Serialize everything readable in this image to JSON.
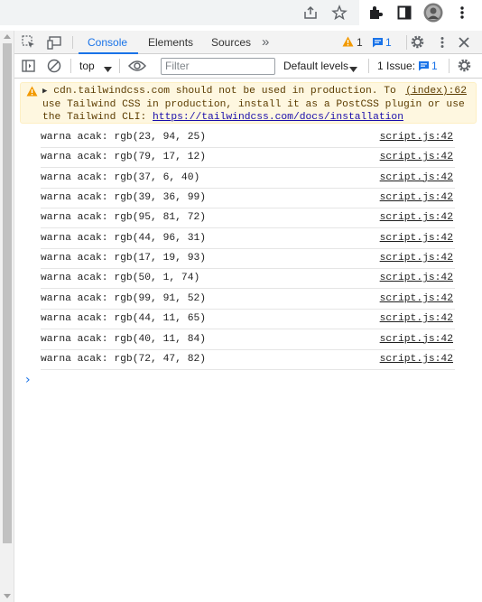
{
  "browser": {
    "icons": [
      "share-icon",
      "star-icon",
      "extensions-icon",
      "side-panel-icon",
      "profile-avatar",
      "menu-icon"
    ]
  },
  "devtools": {
    "tabs": [
      {
        "label": "Console",
        "active": true
      },
      {
        "label": "Elements",
        "active": false
      },
      {
        "label": "Sources",
        "active": false
      }
    ],
    "more_tabs": "»",
    "warning_count": "1",
    "message_count": "1"
  },
  "toolbar": {
    "context": "top",
    "filter_placeholder": "Filter",
    "levels": "Default levels",
    "issues_label": "1 Issue:",
    "issues_count": "1"
  },
  "console": {
    "warning": {
      "line1": "cdn.tailwindcss.com should not be used in production. To",
      "line2": "use Tailwind CSS in production, install it as a PostCSS plugin or use",
      "line3": "the Tailwind CLI: ",
      "link": "https://tailwindcss.com/docs/installation",
      "source": "(index):62"
    },
    "logs": [
      {
        "msg": "warna acak: rgb(23, 94, 25)",
        "src": "script.js:42"
      },
      {
        "msg": "warna acak: rgb(79, 17, 12)",
        "src": "script.js:42"
      },
      {
        "msg": "warna acak: rgb(37, 6, 40)",
        "src": "script.js:42"
      },
      {
        "msg": "warna acak: rgb(39, 36, 99)",
        "src": "script.js:42"
      },
      {
        "msg": "warna acak: rgb(95, 81, 72)",
        "src": "script.js:42"
      },
      {
        "msg": "warna acak: rgb(44, 96, 31)",
        "src": "script.js:42"
      },
      {
        "msg": "warna acak: rgb(17, 19, 93)",
        "src": "script.js:42"
      },
      {
        "msg": "warna acak: rgb(50, 1, 74)",
        "src": "script.js:42"
      },
      {
        "msg": "warna acak: rgb(99, 91, 52)",
        "src": "script.js:42"
      },
      {
        "msg": "warna acak: rgb(44, 11, 65)",
        "src": "script.js:42"
      },
      {
        "msg": "warna acak: rgb(40, 11, 84)",
        "src": "script.js:42"
      },
      {
        "msg": "warna acak: rgb(72, 47, 82)",
        "src": "script.js:42"
      }
    ],
    "prompt": "›"
  },
  "colors": {
    "accent": "#1a73e8",
    "warning_bg": "#fef7e0",
    "warning_icon": "#f29900"
  }
}
